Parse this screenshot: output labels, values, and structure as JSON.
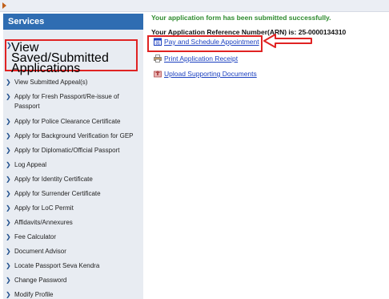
{
  "sidebar": {
    "header": "Services",
    "highlighted_item": "View Saved/Submitted Applications",
    "items": [
      {
        "label": "View Submitted Appeal(s)"
      },
      {
        "label": "Apply for Fresh Passport/Re-issue of Passport"
      },
      {
        "label": "Apply for Police Clearance Certificate"
      },
      {
        "label": "Apply for Background Verification for GEP"
      },
      {
        "label": "Apply for Diplomatic/Official Passport"
      },
      {
        "label": "Log Appeal"
      },
      {
        "label": "Apply for Identity Certificate"
      },
      {
        "label": "Apply for Surrender Certificate"
      },
      {
        "label": "Apply for LoC Permit"
      },
      {
        "label": "Affidavits/Annexures"
      },
      {
        "label": "Fee Calculator"
      },
      {
        "label": "Document Advisor"
      },
      {
        "label": "Locate Passport Seva Kendra"
      },
      {
        "label": "Change Password"
      },
      {
        "label": "Modify Profile"
      }
    ]
  },
  "main": {
    "success_message": "Your application form has been submitted successfully.",
    "arn_text": "Your Application Reference Number(ARN) is: 25-0000134310",
    "links": [
      {
        "label": "Pay and Schedule Appointment",
        "icon": "calendar-icon"
      },
      {
        "label": "Print Application Receipt",
        "icon": "printer-icon"
      },
      {
        "label": "Upload Supporting Documents",
        "icon": "upload-icon"
      }
    ]
  },
  "colors": {
    "header_blue": "#2f6db2",
    "success_green": "#2e8b2e",
    "link_blue": "#1a3fbf",
    "highlight_red": "#e02323",
    "sidebar_bg": "#e8ecf2"
  }
}
